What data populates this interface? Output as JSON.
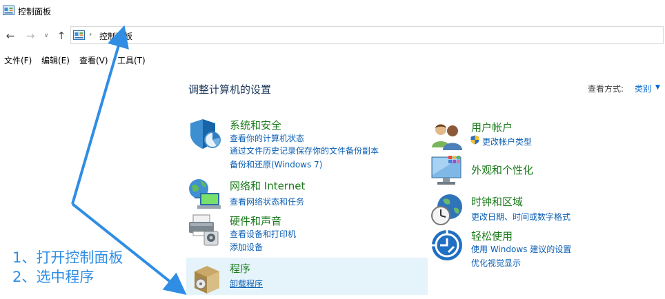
{
  "window": {
    "title": "控制面板"
  },
  "address": {
    "crumb": "控制面板"
  },
  "menu": {
    "file": "文件(F)",
    "edit": "编辑(E)",
    "view": "查看(V)",
    "tools": "工具(T)"
  },
  "header": {
    "title": "调整计算机的设置",
    "view_by_label": "查看方式:",
    "view_by_value": "类别"
  },
  "categories": {
    "system_security": {
      "title": "系统和安全",
      "links": [
        "查看你的计算机状态",
        "通过文件历史记录保存你的文件备份副本",
        "备份和还原(Windows 7)"
      ]
    },
    "network": {
      "title": "网络和 Internet",
      "links": [
        "查看网络状态和任务"
      ]
    },
    "hardware": {
      "title": "硬件和声音",
      "links": [
        "查看设备和打印机",
        "添加设备"
      ]
    },
    "programs": {
      "title": "程序",
      "links": [
        "卸载程序"
      ]
    },
    "user_accounts": {
      "title": "用户帐户",
      "links": [
        "更改帐户类型"
      ]
    },
    "appearance": {
      "title": "外观和个性化",
      "links": []
    },
    "clock_region": {
      "title": "时钟和区域",
      "links": [
        "更改日期、时间或数字格式"
      ]
    },
    "ease_access": {
      "title": "轻松使用",
      "links": [
        "使用 Windows 建议的设置",
        "优化视觉显示"
      ]
    }
  },
  "annotation": {
    "line1": "1、打开控制面板",
    "line2": "2、选中程序"
  },
  "colors": {
    "link": "#0a5fb4",
    "category_title": "#1a7a1a",
    "highlight": "#e5f3fb",
    "annotation": "#2f8de4"
  }
}
